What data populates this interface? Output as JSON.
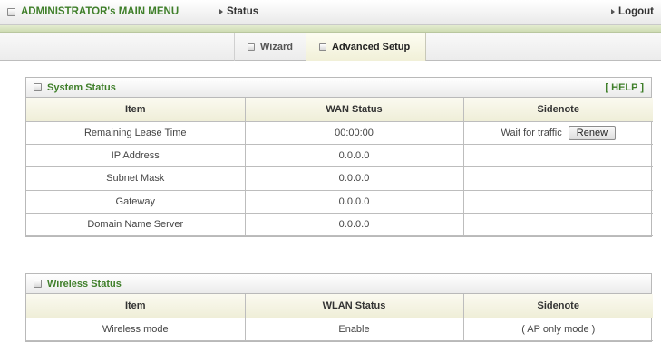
{
  "topbar": {
    "menu_title": "ADMINISTRATOR's MAIN MENU",
    "breadcrumb": "Status",
    "logout": "Logout"
  },
  "tabs": [
    {
      "label": "Wizard",
      "active": false
    },
    {
      "label": "Advanced Setup",
      "active": true
    }
  ],
  "system_status": {
    "title": "System Status",
    "help": "[ HELP ]",
    "headers": [
      "Item",
      "WAN Status",
      "Sidenote"
    ],
    "rows": [
      {
        "item": "Remaining Lease Time",
        "status": "00:00:00",
        "note": "Wait for traffic",
        "button": "Renew"
      },
      {
        "item": "IP Address",
        "status": "0.0.0.0",
        "note": ""
      },
      {
        "item": "Subnet Mask",
        "status": "0.0.0.0",
        "note": ""
      },
      {
        "item": "Gateway",
        "status": "0.0.0.0",
        "note": ""
      },
      {
        "item": "Domain Name Server",
        "status": "0.0.0.0",
        "note": ""
      }
    ]
  },
  "wireless_status": {
    "title": "Wireless Status",
    "headers": [
      "Item",
      "WLAN Status",
      "Sidenote"
    ],
    "rows": [
      {
        "item": "Wireless mode",
        "status": "Enable",
        "note": "( AP only mode )"
      }
    ]
  },
  "colors": {
    "accent_green": "#3f7f2a",
    "header_bg": "#efeed8"
  }
}
